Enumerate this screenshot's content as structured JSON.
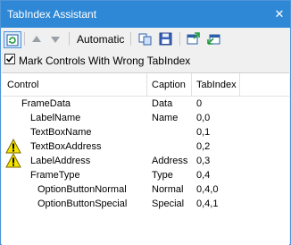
{
  "window": {
    "title": "TabIndex Assistant",
    "close_glyph": "✕"
  },
  "toolbar": {
    "automatic_label": "Automatic",
    "icons": [
      "refresh-icon",
      "arrow-up-icon",
      "arrow-down-icon",
      "copy-icon",
      "save-icon",
      "import-icon",
      "export-icon"
    ]
  },
  "options": {
    "mark_wrong_label": "Mark Controls With Wrong TabIndex",
    "mark_wrong_checked": true
  },
  "grid": {
    "columns": [
      "Control",
      "Caption",
      "TabIndex"
    ],
    "rows": [
      {
        "control": "FrameData",
        "caption": "Data",
        "tabindex": "0",
        "level": 0,
        "warning": false
      },
      {
        "control": "LabelName",
        "caption": "Name",
        "tabindex": "0,0",
        "level": 1,
        "warning": false
      },
      {
        "control": "TextBoxName",
        "caption": "",
        "tabindex": "0,1",
        "level": 1,
        "warning": false
      },
      {
        "control": "TextBoxAddress",
        "caption": "",
        "tabindex": "0,2",
        "level": 1,
        "warning": true
      },
      {
        "control": "LabelAddress",
        "caption": "Address",
        "tabindex": "0,3",
        "level": 1,
        "warning": true
      },
      {
        "control": "FrameType",
        "caption": "Type",
        "tabindex": "0,4",
        "level": 1,
        "warning": false
      },
      {
        "control": "OptionButtonNormal",
        "caption": "Normal",
        "tabindex": "0,4,0",
        "level": 2,
        "warning": false
      },
      {
        "control": "OptionButtonSpecial",
        "caption": "Special",
        "tabindex": "0,4,1",
        "level": 2,
        "warning": false
      }
    ]
  },
  "colors": {
    "titlebar": "#2f88d6",
    "warning": "#f5e400"
  }
}
